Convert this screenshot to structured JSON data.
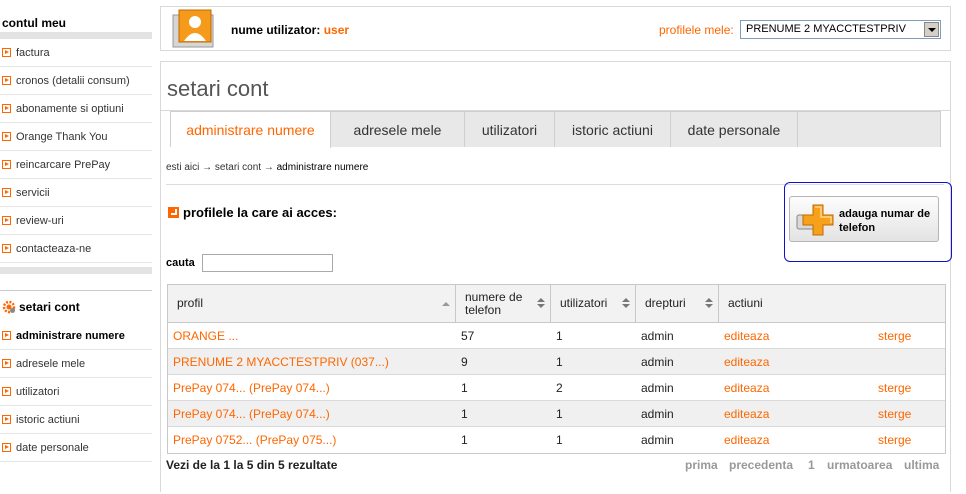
{
  "sidebar": {
    "account_heading": "contul meu",
    "items": [
      {
        "label": "factura"
      },
      {
        "label": "cronos (detalii consum)"
      },
      {
        "label": "abonamente si optiuni"
      },
      {
        "label": "Orange Thank You"
      },
      {
        "label": "reincarcare PrePay"
      },
      {
        "label": "servicii"
      },
      {
        "label": "review-uri"
      },
      {
        "label": "contacteaza-ne"
      }
    ],
    "settings_heading": "setari cont",
    "settings_items": [
      {
        "label": "administrare numere",
        "active": true
      },
      {
        "label": "adresele mele"
      },
      {
        "label": "utilizatori"
      },
      {
        "label": "istoric actiuni"
      },
      {
        "label": "date personale"
      }
    ]
  },
  "topbar": {
    "username_label": "nume utilizator:",
    "username_value": "user",
    "profiles_label": "profilele mele:",
    "profiles_selected": "PRENUME 2 MYACCTESTPRIV"
  },
  "main": {
    "title": "setari cont",
    "tabs": [
      {
        "label": "administrare numere",
        "active": true
      },
      {
        "label": "adresele mele"
      },
      {
        "label": "utilizatori"
      },
      {
        "label": "istoric actiuni"
      },
      {
        "label": "date personale"
      }
    ],
    "breadcrumb": {
      "part1": "esti aici",
      "sep": "→",
      "part2": "setari cont",
      "part3": "administrare numere"
    },
    "access_title": "profilele la care ai acces:",
    "add_button_label": "adauga numar de telefon",
    "search_label": "cauta",
    "search_value": ""
  },
  "table": {
    "headers": [
      "profil",
      "numere de telefon",
      "utilizatori",
      "drepturi",
      "actiuni"
    ],
    "rows": [
      {
        "profil": "ORANGE ...",
        "numere": "57",
        "utilizatori": "1",
        "drepturi": "admin",
        "edit": "editeaza",
        "delete": "sterge"
      },
      {
        "profil": "PRENUME 2 MYACCTESTPRIV (037...)",
        "numere": "9",
        "utilizatori": "1",
        "drepturi": "admin",
        "edit": "editeaza",
        "delete": ""
      },
      {
        "profil": "PrePay 074... (PrePay 074...)",
        "numere": "1",
        "utilizatori": "2",
        "drepturi": "admin",
        "edit": "editeaza",
        "delete": "sterge"
      },
      {
        "profil": "PrePay 074... (PrePay 074...)",
        "numere": "1",
        "utilizatori": "1",
        "drepturi": "admin",
        "edit": "editeaza",
        "delete": "sterge"
      },
      {
        "profil": "PrePay 0752... (PrePay 075...)",
        "numere": "1",
        "utilizatori": "1",
        "drepturi": "admin",
        "edit": "editeaza",
        "delete": "sterge"
      }
    ]
  },
  "footer": {
    "results_text": "Vezi de la 1 la 5 din 5 rezultate",
    "pager": {
      "first": "prima",
      "prev": "precedenta",
      "page": "1",
      "next": "urmatoarea",
      "last": "ultima"
    }
  },
  "colors": {
    "accent": "#ff6600",
    "highlight_border": "#1111cc"
  }
}
